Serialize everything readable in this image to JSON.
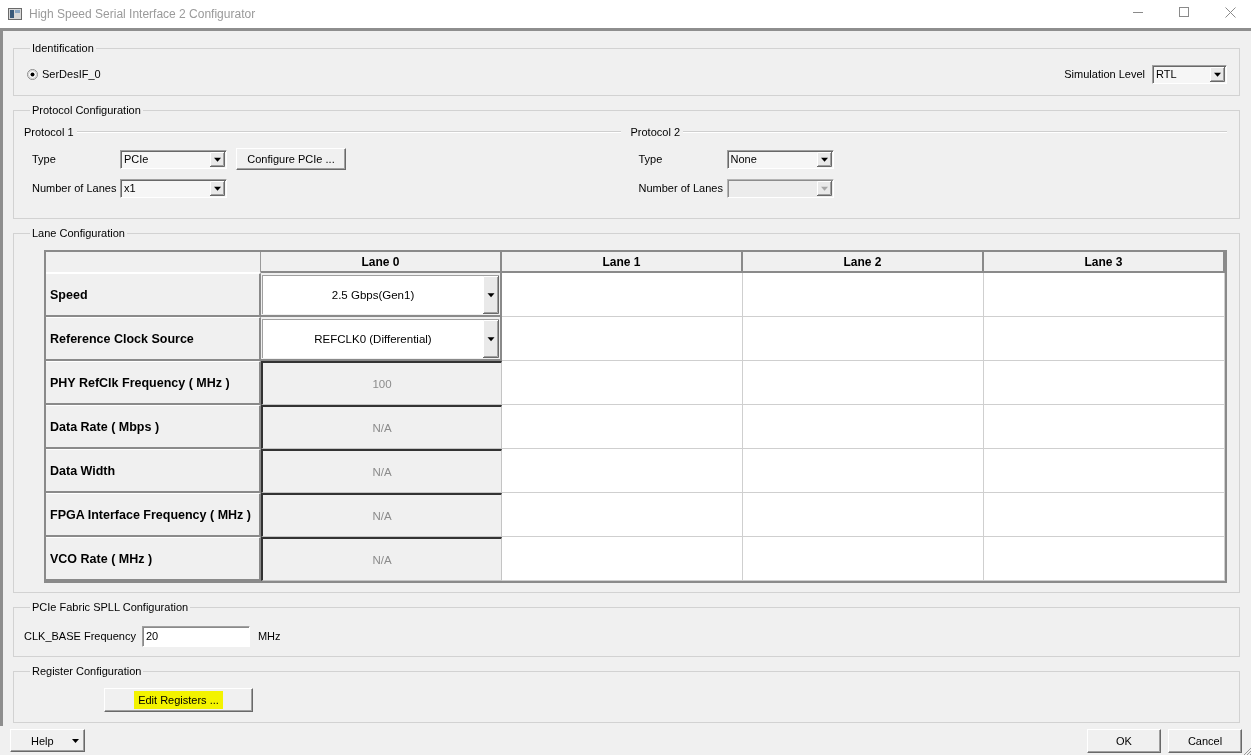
{
  "window": {
    "title": "High Speed Serial Interface 2 Configurator"
  },
  "identification": {
    "title": "Identification",
    "instance": {
      "label": "SerDesIF_0",
      "selected": true
    },
    "simulation_level": {
      "label": "Simulation Level",
      "value": "RTL"
    }
  },
  "protocol_configuration": {
    "title": "Protocol Configuration",
    "protocols": [
      {
        "title": "Protocol 1",
        "type": {
          "label": "Type",
          "value": "PCIe"
        },
        "configure_button": "Configure PCIe ...",
        "lanes": {
          "label": "Number of Lanes",
          "value": "x1",
          "disabled": false
        }
      },
      {
        "title": "Protocol 2",
        "type": {
          "label": "Type",
          "value": "None"
        },
        "lanes": {
          "label": "Number of Lanes",
          "disabled": true
        }
      }
    ]
  },
  "lane_configuration": {
    "title": "Lane Configuration",
    "columns": [
      "Lane 0",
      "Lane 1",
      "Lane 2",
      "Lane 3"
    ],
    "rows": [
      {
        "label": "Speed",
        "kind": "dropdown",
        "value": "2.5 Gbps(Gen1)"
      },
      {
        "label": "Reference Clock Source",
        "kind": "dropdown",
        "value": "REFCLK0 (Differential)"
      },
      {
        "label": "PHY RefClk Frequency ( MHz )",
        "kind": "readonly",
        "value": "100"
      },
      {
        "label": "Data Rate ( Mbps )",
        "kind": "readonly",
        "value": "N/A"
      },
      {
        "label": "Data Width",
        "kind": "readonly",
        "value": "N/A"
      },
      {
        "label": "FPGA Interface Frequency ( MHz )",
        "kind": "readonly",
        "value": "N/A"
      },
      {
        "label": "VCO Rate ( MHz )",
        "kind": "readonly",
        "value": "N/A"
      }
    ]
  },
  "spll_configuration": {
    "title": "PCIe Fabric SPLL Configuration",
    "field": {
      "label": "CLK_BASE Frequency",
      "value": "20",
      "unit": "MHz"
    }
  },
  "register_configuration": {
    "title": "Register Configuration",
    "button": {
      "label": "Edit Registers ...",
      "highlighted": true
    }
  },
  "footer": {
    "help_button": "Help",
    "ok_button": "OK",
    "cancel_button": "Cancel"
  }
}
